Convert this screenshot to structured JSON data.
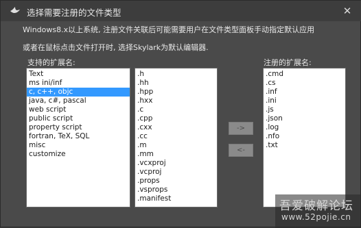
{
  "window": {
    "title": "选择需要注册的文件类型",
    "close_glyph": "✕"
  },
  "description": {
    "line1": "Windows8.x以上系统, 注册文件关联后可能需要用户在文件类型面板手动指定默认应用",
    "line2": "或者在鼠标点击文件打开时, 选择Skylark为默认编辑器."
  },
  "supported": {
    "label": "支持的扩展名:",
    "items": [
      "Text",
      "ms ini/inf",
      "c, c++, objc",
      "java, c#, pascal",
      "web script",
      "public script",
      "property script",
      "fortran, TeX, SQL",
      "misc",
      "customize"
    ],
    "selected_index": 2
  },
  "extensions": {
    "items": [
      ".h",
      ".hh",
      ".hpp",
      ".hxx",
      ".c",
      ".cpp",
      ".cxx",
      ".cc",
      ".m",
      ".mm",
      ".vcxproj",
      ".vcproj",
      ".props",
      ".vsprops",
      ".manifest"
    ]
  },
  "buttons": {
    "add_label": "->",
    "remove_label": "<-"
  },
  "registered": {
    "label": "注册的扩展名:",
    "items": [
      ".cmd",
      ".cs",
      ".inf",
      ".ini",
      ".js",
      ".json",
      ".log",
      ".nfo",
      ".txt"
    ]
  },
  "watermark": {
    "line1": "吾爱破解论坛",
    "line2": "www.52pojie.cn"
  },
  "colors": {
    "selection": "#3399ff",
    "dialog_bg": "#4a4a4a",
    "titlebar_bg": "#3d3d3d"
  }
}
